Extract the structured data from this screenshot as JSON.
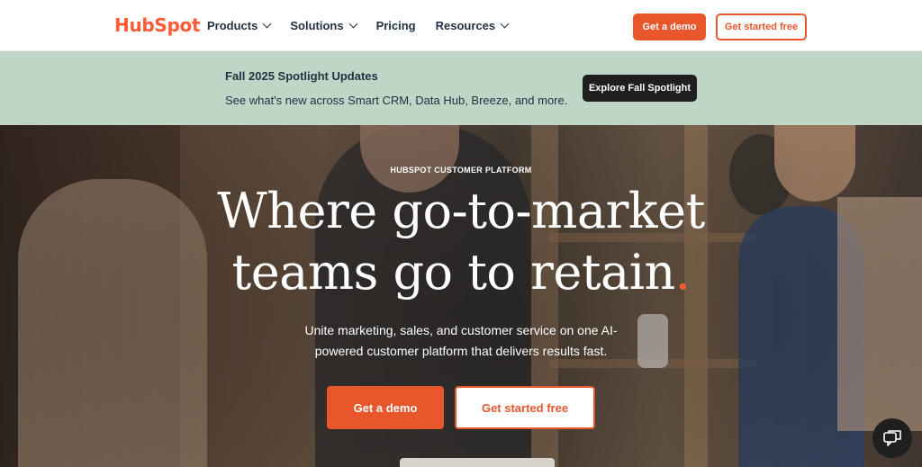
{
  "nav": {
    "logo": "HubSpot",
    "items": [
      {
        "label": "Products",
        "dropdown": true
      },
      {
        "label": "Solutions",
        "dropdown": true
      },
      {
        "label": "Pricing",
        "dropdown": false
      },
      {
        "label": "Resources",
        "dropdown": true
      }
    ],
    "demo_label": "Get a demo",
    "free_label": "Get started free"
  },
  "banner": {
    "title": "Fall 2025 Spotlight Updates",
    "text": "See what's new across Smart CRM, Data Hub, Breeze, and more.",
    "cta": "Explore Fall Spotlight"
  },
  "hero": {
    "eyebrow": "HUBSPOT CUSTOMER PLATFORM",
    "headline_line1": "Where go-to-market",
    "headline_line2": "teams go to retain",
    "headline_accent": ".",
    "subtext": "Unite marketing, sales, and customer service on one AI-powered customer platform that delivers results fast.",
    "demo_label": "Get a demo",
    "free_label": "Get started free"
  },
  "chat": {
    "icon": "chat-icon"
  },
  "colors": {
    "brand_orange": "#ff5c35",
    "button_orange": "#e8562c",
    "banner_bg": "#bfd5c6",
    "dark": "#213343"
  }
}
